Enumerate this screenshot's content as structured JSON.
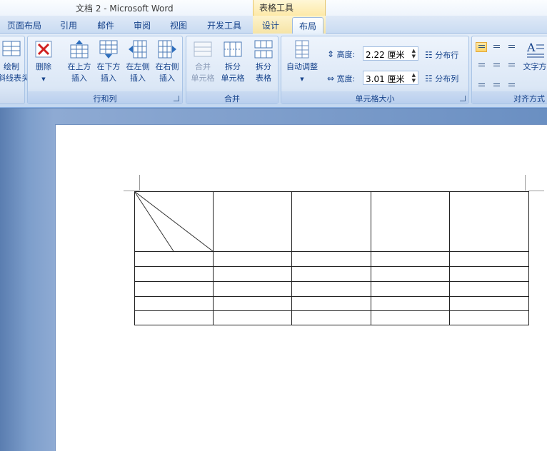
{
  "titlebar": {
    "title": "文档 2 - Microsoft Word",
    "context_label": "表格工具"
  },
  "tabs": [
    {
      "label": "页面布局"
    },
    {
      "label": "引用"
    },
    {
      "label": "邮件"
    },
    {
      "label": "审阅"
    },
    {
      "label": "视图"
    },
    {
      "label": "开发工具"
    },
    {
      "label": "设计"
    },
    {
      "label": "布局",
      "active": true
    }
  ],
  "ribbon": {
    "draw_group": {
      "line1": "绘制",
      "line2": "斜线表头"
    },
    "rows_cols": {
      "title": "行和列",
      "delete": "删除",
      "insert_above": {
        "line1": "在上方",
        "line2": "插入"
      },
      "insert_below": {
        "line1": "在下方",
        "line2": "插入"
      },
      "insert_left": {
        "line1": "在左侧",
        "line2": "插入"
      },
      "insert_right": {
        "line1": "在右侧",
        "line2": "插入"
      }
    },
    "merge": {
      "title": "合并",
      "merge_cells": {
        "line1": "合并",
        "line2": "单元格"
      },
      "split_cells": {
        "line1": "拆分",
        "line2": "单元格"
      },
      "split_table": {
        "line1": "拆分",
        "line2": "表格"
      }
    },
    "cell_size": {
      "title": "单元格大小",
      "autofit": "自动调整",
      "height_label": "高度:",
      "height_value": "2.22 厘米",
      "width_label": "宽度:",
      "width_value": "3.01 厘米",
      "distribute_rows": "分布行",
      "distribute_cols": "分布列"
    },
    "alignment": {
      "title": "对齐方式",
      "text_direction": "文字方"
    }
  },
  "document": {
    "table": {
      "rows": 6,
      "cols": 5,
      "diagonal_header_lines": 2
    }
  },
  "colors": {
    "accent": "#15428b",
    "ribbon_bg": "#dbe7f6",
    "context_tab": "#fde9a8",
    "doc_bg": "#6a8fc2"
  }
}
